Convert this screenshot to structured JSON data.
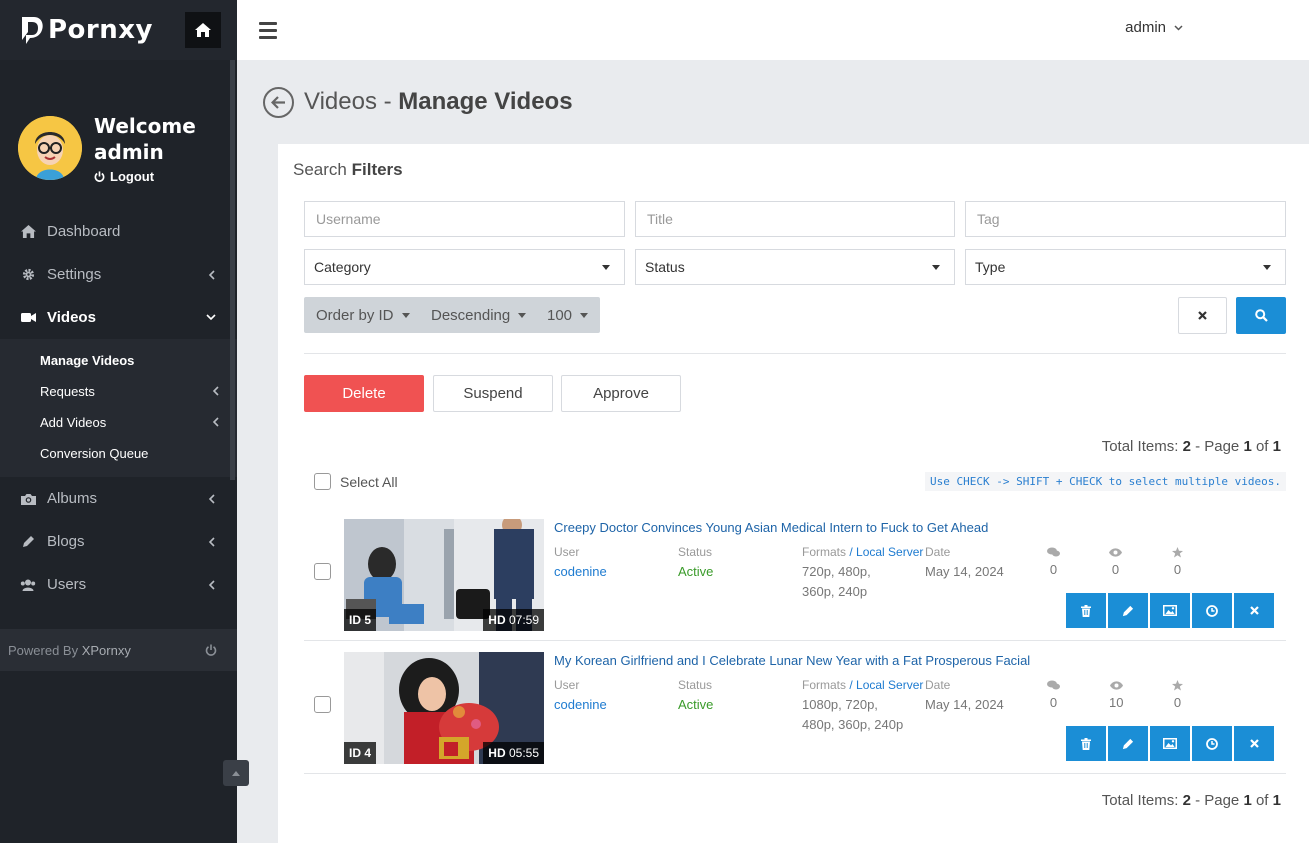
{
  "brand": {
    "name": "Pornxy"
  },
  "user": {
    "welcome": "Welcome",
    "name": "admin",
    "logout": "Logout"
  },
  "nav": {
    "dashboard": "Dashboard",
    "settings": "Settings",
    "videos": "Videos",
    "albums": "Albums",
    "blogs": "Blogs",
    "users": "Users"
  },
  "subnav": {
    "manage_videos": "Manage Videos",
    "requests": "Requests",
    "add_videos": "Add Videos",
    "conversion_queue": "Conversion Queue"
  },
  "footer": {
    "powered_by": "Powered By",
    "product": "XPornxy"
  },
  "topbar": {
    "admin_label": "admin"
  },
  "header": {
    "section": "Videos",
    "separator": " - ",
    "title": "Manage Videos"
  },
  "filters": {
    "title_light": "Search",
    "title_bold": "Filters",
    "username_placeholder": "Username",
    "title_placeholder": "Title",
    "tag_placeholder": "Tag",
    "category": "Category",
    "status": "Status",
    "type": "Type",
    "order_by": "Order by ID",
    "direction": "Descending",
    "per_page": "100"
  },
  "actions": {
    "delete": "Delete",
    "suspend": "Suspend",
    "approve": "Approve"
  },
  "pagination": {
    "total_label": "Total Items:",
    "total": "2",
    "page_label": "- Page",
    "page": "1",
    "of_label": "of",
    "pages": "1"
  },
  "list": {
    "select_all": "Select All",
    "hint": "Use CHECK -> SHIFT + CHECK to select multiple videos.",
    "labels": {
      "user": "User",
      "status": "Status",
      "formats": "Formats",
      "formats_server": "/ Local Server",
      "date": "Date"
    }
  },
  "videos": [
    {
      "id_label": "ID 5",
      "hd": "HD",
      "duration": "07:59",
      "title": "Creepy Doctor Convinces Young Asian Medical Intern to Fuck to Get Ahead",
      "user": "codenine",
      "status": "Active",
      "formats_line1": "720p, 480p,",
      "formats_line2": "360p, 240p",
      "date": "May 14, 2024",
      "comments": "0",
      "views": "0",
      "favorites": "0"
    },
    {
      "id_label": "ID 4",
      "hd": "HD",
      "duration": "05:55",
      "title": "My Korean Girlfriend and I Celebrate Lunar New Year with a Fat Prosperous Facial",
      "user": "codenine",
      "status": "Active",
      "formats_line1": "1080p, 720p,",
      "formats_line2": "480p, 360p, 240p",
      "date": "May 14, 2024",
      "comments": "0",
      "views": "10",
      "favorites": "0"
    }
  ],
  "colors": {
    "sidebar_bg": "#1f2329",
    "primary": "#1b8ed6",
    "danger": "#f05252",
    "active_status": "#3a9b2a",
    "link": "#1e64a8"
  }
}
